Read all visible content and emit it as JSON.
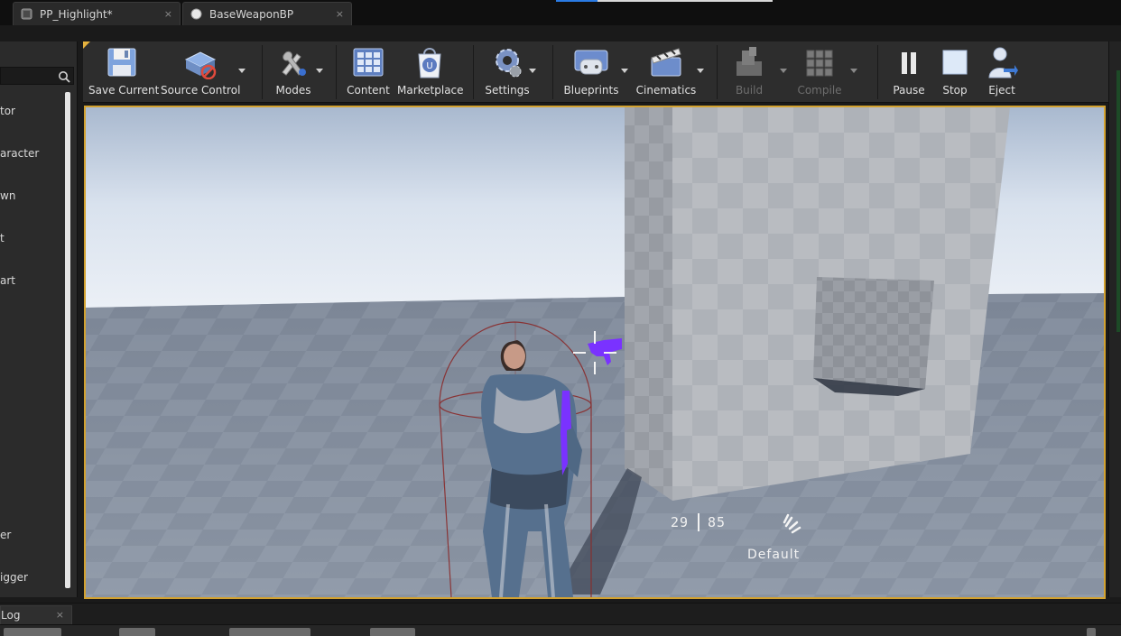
{
  "tabs": [
    {
      "label": "PP_Highlight*",
      "close": "×"
    },
    {
      "label": "BaseWeaponBP",
      "close": "×"
    }
  ],
  "left_panel": {
    "items": [
      "tor",
      "aracter",
      "wn",
      "t",
      "art",
      "er",
      "igger"
    ]
  },
  "toolbar": {
    "buttons": [
      {
        "label": "Save Current",
        "icon": "save-icon"
      },
      {
        "label": "Source Control",
        "icon": "source-control-icon"
      },
      {
        "label": "Modes",
        "icon": "modes-icon"
      },
      {
        "label": "Content",
        "icon": "content-icon"
      },
      {
        "label": "Marketplace",
        "icon": "marketplace-icon"
      },
      {
        "label": "Settings",
        "icon": "settings-icon"
      },
      {
        "label": "Blueprints",
        "icon": "blueprints-icon"
      },
      {
        "label": "Cinematics",
        "icon": "cinematics-icon"
      },
      {
        "label": "Build",
        "icon": "build-icon",
        "disabled": true
      },
      {
        "label": "Compile",
        "icon": "compile-icon",
        "disabled": true
      },
      {
        "label": "Pause",
        "icon": "pause-icon"
      },
      {
        "label": "Stop",
        "icon": "stop-icon"
      },
      {
        "label": "Eject",
        "icon": "eject-icon"
      }
    ]
  },
  "hud": {
    "ammo_current": "29",
    "ammo_total": "85",
    "fire_mode": "Default"
  },
  "bottom": {
    "log_tab": "Log",
    "log_close": "×"
  },
  "colors": {
    "viewport_border": "#d3a230",
    "weapon_highlight": "#7a32ff",
    "capsule": "#8a2a2a"
  }
}
